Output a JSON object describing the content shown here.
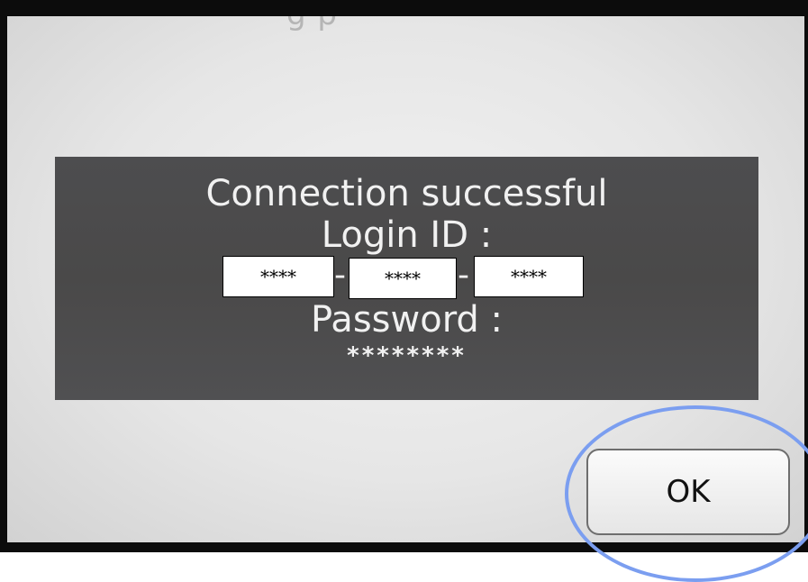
{
  "dialog": {
    "top_text": "g p",
    "heading": "Connection successful",
    "login_label": "Login ID :",
    "login_id_segments": [
      "****",
      "****",
      "****"
    ],
    "separator": "-",
    "password_label": "Password :",
    "password_value": "********"
  },
  "ok_button": {
    "label": "OK"
  },
  "colors": {
    "panel": "#4b4b4d",
    "panel_text": "#f1f1f1",
    "screen": "#e6e6e6",
    "highlight": "#7b9ef0"
  }
}
